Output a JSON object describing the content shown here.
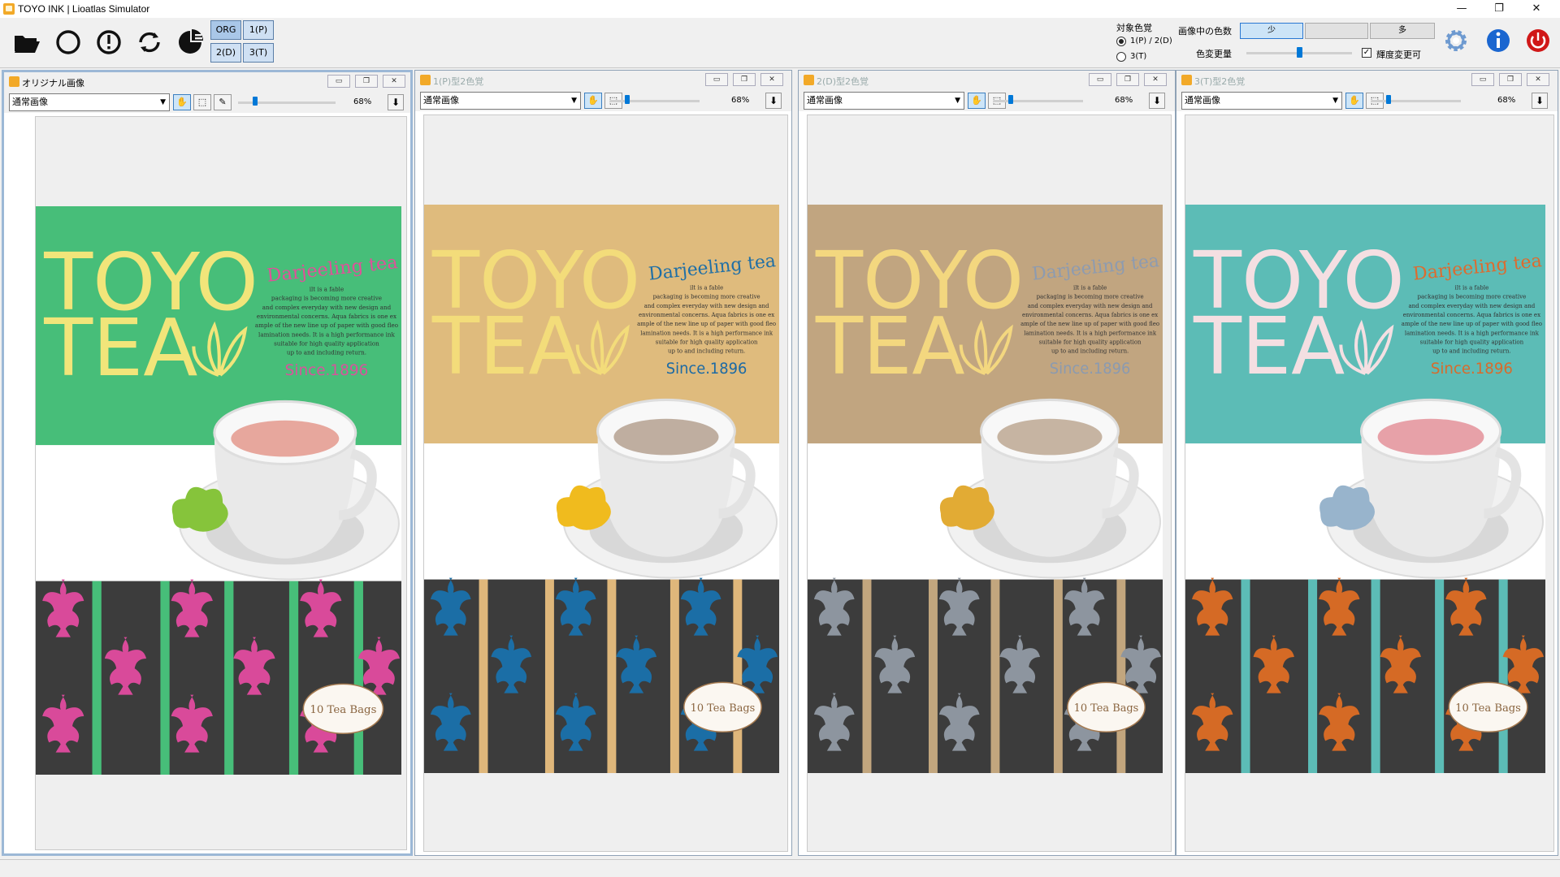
{
  "window": {
    "title": "TOYO INK | Lioatlas Simulator",
    "controls": [
      "—",
      "❐",
      "✕"
    ]
  },
  "toolbar": {
    "icons": [
      "open-folder-icon",
      "circle-icon",
      "alert-icon",
      "refresh-icon",
      "pie-icon"
    ],
    "modes": [
      "ORG",
      "1(P)",
      "2(D)",
      "3(T)"
    ],
    "target_label": "対象色覚",
    "target_options": [
      "1(P) / 2(D)",
      "3(T)"
    ],
    "target_selected": 0,
    "colors_label": "画像中の色数",
    "colors_levels": [
      "少",
      "",
      "多"
    ],
    "colors_selected": 0,
    "change_label": "色変更量",
    "change_level": 0.5,
    "brightness_label": "輝度変更可",
    "brightness_checked": true
  },
  "panels": [
    {
      "title": "オリジナル画像",
      "mode": "通常画像",
      "zoom": "68%",
      "main": true,
      "colors": {
        "band": "#47be79",
        "toyo": "#f1e57a",
        "darj": "#e0509a",
        "since": "#d8539d",
        "tea": "#e7a79d",
        "leaf": "#86c43b",
        "pattern": "#d94a9a",
        "stripe": "#47be79"
      }
    },
    {
      "title": "1(P)型2色覚",
      "mode": "通常画像",
      "zoom": "68%",
      "main": false,
      "colors": {
        "band": "#dfbb7d",
        "toyo": "#f3dc7a",
        "darj": "#1f6fa6",
        "since": "#1c6aa4",
        "tea": "#bfaea0",
        "leaf": "#f0bb1e",
        "pattern": "#1b6ea6",
        "stripe": "#dfb77b"
      }
    },
    {
      "title": "2(D)型2色覚",
      "mode": "通常画像",
      "zoom": "68%",
      "main": false,
      "colors": {
        "band": "#c1a580",
        "toyo": "#f3d77f",
        "darj": "#8d9bb0",
        "since": "#8a9ab0",
        "tea": "#c6b4a2",
        "leaf": "#e2ab34",
        "pattern": "#8d959f",
        "stripe": "#c2a67e"
      }
    },
    {
      "title": "3(T)型2色覚",
      "mode": "通常画像",
      "zoom": "68%",
      "main": false,
      "colors": {
        "band": "#5cbcb6",
        "toyo": "#f4dfe2",
        "darj": "#de6b2e",
        "since": "#d86b2b",
        "tea": "#e7a1a8",
        "leaf": "#98b4cc",
        "pattern": "#d56a25",
        "stripe": "#5cbcb6"
      }
    }
  ],
  "artwork": {
    "toyo": "TOYO",
    "tea": "TEA",
    "darjeeling": "Darjeeling tea",
    "body_lines": [
      "ilt is a fable",
      "packaging is becoming more creative",
      "and complex everyday with new design and",
      "environmental concerns. Aqua fabrics is one ex",
      "ample of the new line up of paper with good fleo",
      "lamination needs. It is a high performance ink",
      "suitable for high quality application",
      "up to and including return."
    ],
    "since": "Since.1896",
    "tea_bags": "10 Tea Bags"
  }
}
